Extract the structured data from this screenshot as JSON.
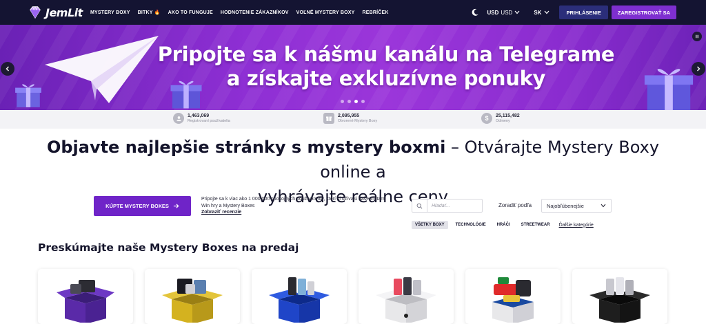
{
  "brand": {
    "name": "JemLit"
  },
  "nav": {
    "items": [
      {
        "label": "MYSTERY BOXY"
      },
      {
        "label": "BITKY",
        "icon": "fire-icon"
      },
      {
        "label": "AKO TO FUNGUJE"
      },
      {
        "label": "HODNOTENIE ZÁKAZNÍKOV"
      },
      {
        "label": "VOĽNÉ MYSTERY BOXY"
      },
      {
        "label": "REBRÍČEK"
      }
    ],
    "currency_code": "USD",
    "currency_name": "USD",
    "language": "SK",
    "login": "PRIHLÁSENIE",
    "register": "ZAREGISTROVAŤ SA"
  },
  "banner": {
    "line1": "Pripojte sa k nášmu kanálu na Telegrame",
    "line2": "a získajte exkluzívne ponuky",
    "slides": 4,
    "active_slide": 2
  },
  "stats": [
    {
      "value": "1,463,069",
      "label": "Registrovaní používatelia",
      "icon": "user-icon"
    },
    {
      "value": "2,095,955",
      "label": "Otvorené Mystery Boxy",
      "icon": "box-icon"
    },
    {
      "value": "25,115,482",
      "label": "Odmeny",
      "icon": "dollar-icon"
    }
  ],
  "headline": {
    "bold": "Objavte najlepšie stránky s mystery boxmi",
    "rest_line1": " – Otvárajte Mystery Boxy online a",
    "line2": "vyhrávajte reálne ceny"
  },
  "cta": {
    "button": "KÚPTE MYSTERY BOXES",
    "description": "Pripojte sa k viac ako 1 000 000 spokojných používateľov, ktorí si užívajú naše Instant Win hry a Mystery Boxes",
    "reviews_link": "Zobraziť recenzie"
  },
  "search": {
    "placeholder": "Hľadať..."
  },
  "sort": {
    "label": "Zoradiť podľa",
    "value": "Najobľúbenejšie"
  },
  "filters": {
    "chips": [
      "VŠETKY BOXY",
      "TECHNOLÓGIE",
      "HRÁČI",
      "STREETWEAR"
    ],
    "active": 0,
    "more": "Ďalšie kategórie"
  },
  "section": {
    "title": "Preskúmajte naše Mystery Boxes na predaj"
  },
  "cards": [
    {
      "name": "apple-mystery-box",
      "box_color": "#5a2aa8"
    },
    {
      "name": "tech-mystery-box",
      "box_color": "#d4b21f"
    },
    {
      "name": "samsung-mystery-box",
      "box_color": "#1f45c8"
    },
    {
      "name": "iphone-mystery-box",
      "box_color": "#e8e8ea"
    },
    {
      "name": "las-vegas-mystery-box",
      "box_color": "#e02a2a"
    },
    {
      "name": "iphone-pro-mystery-box",
      "box_color": "#161616"
    }
  ]
}
